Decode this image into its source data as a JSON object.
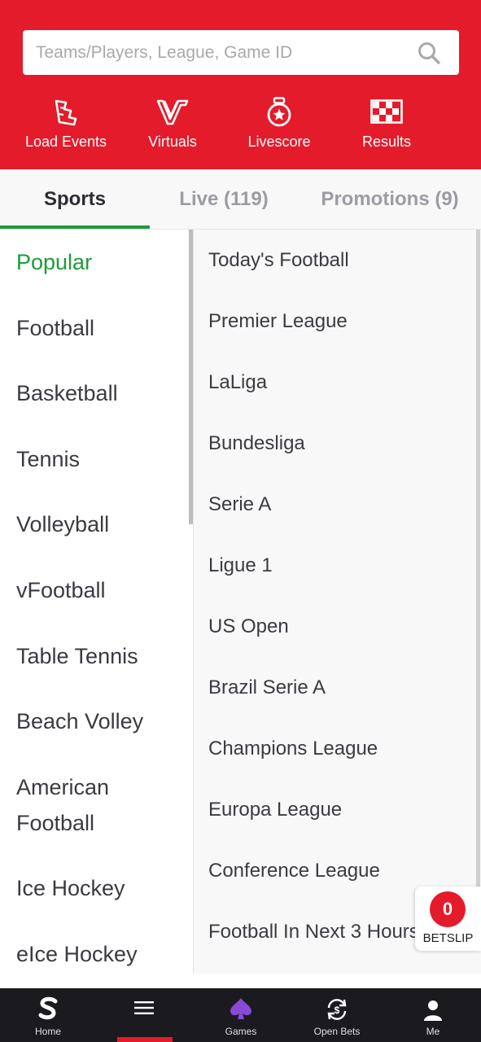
{
  "search": {
    "placeholder": "Teams/Players, League, Game ID",
    "icon": "search-icon"
  },
  "quick_links": [
    {
      "label": "Load Events",
      "icon": "load-events-icon"
    },
    {
      "label": "Virtuals",
      "icon": "virtuals-icon"
    },
    {
      "label": "Livescore",
      "icon": "livescore-icon"
    },
    {
      "label": "Results",
      "icon": "results-flag-icon"
    }
  ],
  "tabs": [
    {
      "label": "Sports",
      "active": true
    },
    {
      "label": "Live (119)",
      "active": false
    },
    {
      "label": "Promotions (9)",
      "active": false
    }
  ],
  "sports": [
    {
      "label": "Popular",
      "active": true
    },
    {
      "label": "Football"
    },
    {
      "label": "Basketball"
    },
    {
      "label": "Tennis"
    },
    {
      "label": "Volleyball"
    },
    {
      "label": "vFootball"
    },
    {
      "label": "Table Tennis"
    },
    {
      "label": "Beach Volley"
    },
    {
      "label": "American Football"
    },
    {
      "label": "Ice Hockey"
    },
    {
      "label": "eIce Hockey"
    }
  ],
  "leagues": [
    "Today's Football",
    "Premier League",
    "LaLiga",
    "Bundesliga",
    "Serie A",
    "Ligue 1",
    "US Open",
    "Brazil Serie A",
    "Champions League",
    "Europa League",
    "Conference League",
    "Football In Next 3 Hours"
  ],
  "betslip": {
    "count": "0",
    "label": "BETSLIP"
  },
  "bottom_nav": [
    {
      "label": "Home",
      "icon": "home-s-icon"
    },
    {
      "label": "",
      "icon": "menu-icon",
      "active": true
    },
    {
      "label": "Games",
      "icon": "spade-icon"
    },
    {
      "label": "Open Bets",
      "icon": "open-bets-icon"
    },
    {
      "label": "Me",
      "icon": "user-icon"
    }
  ],
  "colors": {
    "brand_red": "#e41b2b",
    "active_green": "#1e9b3c",
    "nav_dark": "#1b1b1f"
  }
}
